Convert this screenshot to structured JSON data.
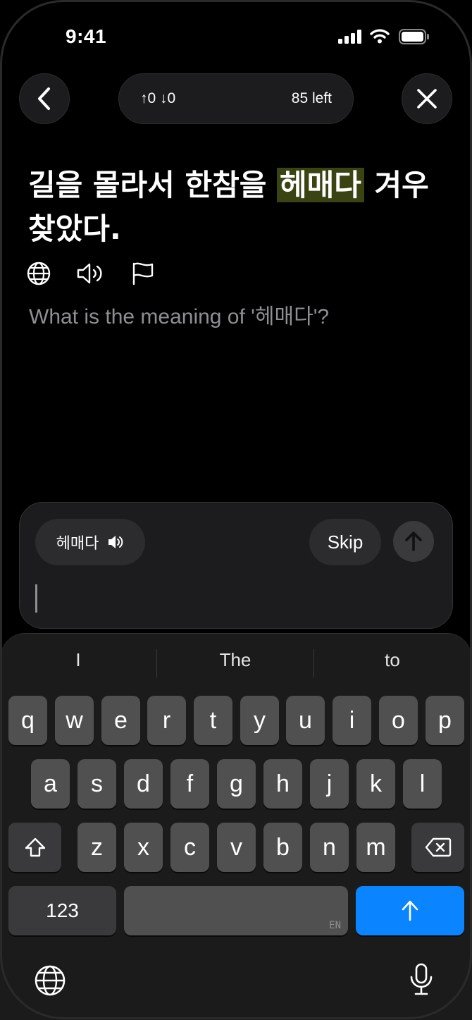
{
  "status": {
    "time": "9:41"
  },
  "header": {
    "votes": "↑0 ↓0",
    "remaining": "85 left"
  },
  "sentence": {
    "before": "길을 몰라서 한참을 ",
    "highlight": "헤매다",
    "after": " 겨우 찾았다."
  },
  "question": "What is the meaning of '헤매다'?",
  "answer": {
    "word_chip": "헤매다",
    "skip_label": "Skip",
    "input_value": ""
  },
  "keyboard": {
    "suggestions": [
      "I",
      "The",
      "to"
    ],
    "row1": [
      "q",
      "w",
      "e",
      "r",
      "t",
      "y",
      "u",
      "i",
      "o",
      "p"
    ],
    "row2": [
      "a",
      "s",
      "d",
      "f",
      "g",
      "h",
      "j",
      "k",
      "l"
    ],
    "row3": [
      "z",
      "x",
      "c",
      "v",
      "b",
      "n",
      "m"
    ],
    "numbers_label": "123",
    "space_lang": "EN"
  },
  "colors": {
    "highlight": "#3a4412",
    "accent": "#0a84ff"
  }
}
